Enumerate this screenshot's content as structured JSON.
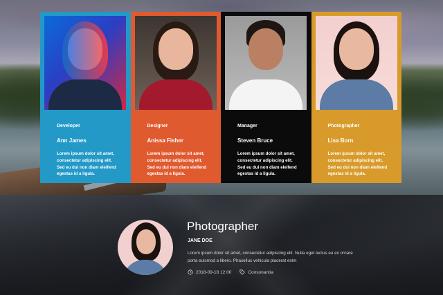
{
  "team": [
    {
      "role": "Developer",
      "name": "Ann James",
      "bio": "Lorem ipsum dolor sit amet, consectetur adipiscing elit. Sed eu dui non diam eleifend egestas id a ligula.",
      "color": "#2399c8"
    },
    {
      "role": "Designer",
      "name": "Anissa Fisher",
      "bio": "Lorem ipsum dolor sit amet, consectetur adipiscing elit. Sed eu dui non diam eleifend egestas id a ligula.",
      "color": "#e05a2f"
    },
    {
      "role": "Manager",
      "name": "Steven Bruce",
      "bio": "Lorem ipsum dolor sit amet, consectetur adipiscing elit. Sed eu dui non diam eleifend egestas id a ligula.",
      "color": "#0b0b0c"
    },
    {
      "role": "Photographer",
      "name": "Lisa Born",
      "bio": "Lorem ipsum dolor sit amet, consectetur adipiscing elit. Sed eu dui non diam eleifend egestas id a ligula.",
      "color": "#d89b2b"
    }
  ],
  "profile": {
    "title": "Photographer",
    "name": "JANE DOE",
    "text": "Lorem ipsum dolor sit amet, consectetur adipiscing elit. Nulla eget lectus eu ex ornare porta euismod a libero. Phasellus vehicula placerat enim",
    "date": "2018-09-18 12:00",
    "tag": "Consonantia",
    "date_icon": "clock-icon",
    "tag_icon": "tag-icon"
  }
}
